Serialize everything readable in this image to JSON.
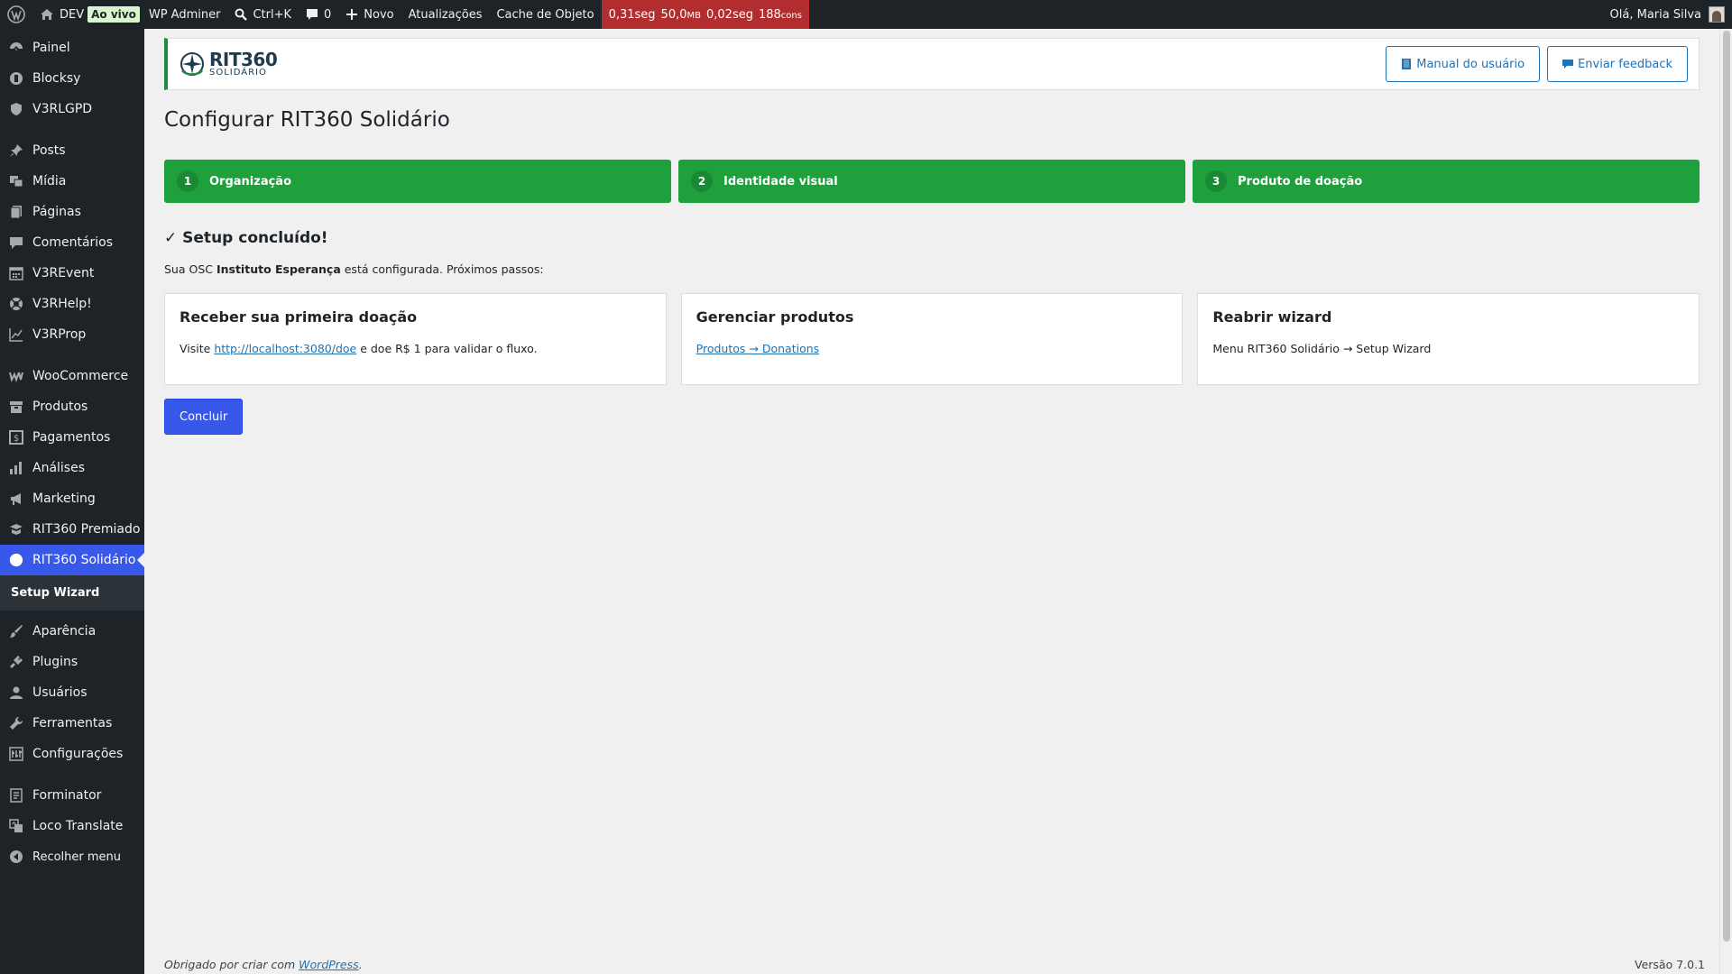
{
  "adminbar": {
    "site": "DEV",
    "live_badge": "Ao vivo",
    "adminer": "WP Adminer",
    "search": "Ctrl+K",
    "comments_count": "0",
    "new": "Novo",
    "updates": "Atualizações",
    "cache": "Cache de Objeto",
    "perf": {
      "time1": "0,31seg",
      "mem_value": "50,0",
      "mem_unit": "MB",
      "time2": "0,02seg",
      "queries_value": "188",
      "queries_unit": "cons"
    },
    "greeting": "Olá, Maria Silva"
  },
  "sidebar": {
    "items": [
      {
        "label": "Painel",
        "icon": "dashboard-icon"
      },
      {
        "label": "Blocksy",
        "icon": "blocksy-icon"
      },
      {
        "label": "V3RLGPD",
        "icon": "shield-icon"
      },
      {
        "label": "Posts",
        "icon": "pin-icon"
      },
      {
        "label": "Mídia",
        "icon": "media-icon"
      },
      {
        "label": "Páginas",
        "icon": "pages-icon"
      },
      {
        "label": "Comentários",
        "icon": "comment-icon"
      },
      {
        "label": "V3REvent",
        "icon": "calendar-icon"
      },
      {
        "label": "V3RHelp!",
        "icon": "help-icon"
      },
      {
        "label": "V3RProp",
        "icon": "chart-line-icon"
      },
      {
        "label": "WooCommerce",
        "icon": "woo-icon"
      },
      {
        "label": "Produtos",
        "icon": "archive-icon"
      },
      {
        "label": "Pagamentos",
        "icon": "money-icon"
      },
      {
        "label": "Análises",
        "icon": "bar-chart-icon"
      },
      {
        "label": "Marketing",
        "icon": "megaphone-icon"
      },
      {
        "label": "RIT360 Premiado",
        "icon": "award-icon"
      },
      {
        "label": "RIT360 Solidário",
        "icon": "circle-icon"
      },
      {
        "label": "Aparência",
        "icon": "brush-icon"
      },
      {
        "label": "Plugins",
        "icon": "plugin-icon"
      },
      {
        "label": "Usuários",
        "icon": "user-icon"
      },
      {
        "label": "Ferramentas",
        "icon": "wrench-icon"
      },
      {
        "label": "Configurações",
        "icon": "settings-icon"
      },
      {
        "label": "Forminator",
        "icon": "form-icon"
      },
      {
        "label": "Loco Translate",
        "icon": "translate-icon"
      }
    ],
    "submenu": "Setup Wizard",
    "collapse": "Recolher menu"
  },
  "header": {
    "logo_main": "RIT360",
    "logo_sub": "SOLIDÁRIO",
    "manual_btn": "Manual do usuário",
    "feedback_btn": "Enviar feedback"
  },
  "page_title": "Configurar RIT360 Solidário",
  "steps": [
    {
      "num": "1",
      "label": "Organização"
    },
    {
      "num": "2",
      "label": "Identidade visual"
    },
    {
      "num": "3",
      "label": "Produto de doação"
    }
  ],
  "done": {
    "title": "✓ Setup concluído!",
    "pre": "Sua OSC ",
    "org": "Instituto Esperança",
    "post": " está configurada. Próximos passos:"
  },
  "cards": [
    {
      "title": "Receber sua primeira doação",
      "pre": "Visite ",
      "link": "http://localhost:3080/doe",
      "post": " e doe R$ 1 para validar o fluxo."
    },
    {
      "title": "Gerenciar produtos",
      "link": "Produtos → Donations"
    },
    {
      "title": "Reabrir wizard",
      "text": "Menu RIT360 Solidário → Setup Wizard"
    }
  ],
  "primary_btn": "Concluir",
  "footer": {
    "pre": "Obrigado por criar com ",
    "link": "WordPress",
    "post": ".",
    "version": "Versão 7.0.1"
  },
  "colors": {
    "step_green": "#1ea03c",
    "accent_blue": "#3858e9",
    "admin_dark": "#1d2327",
    "perf_red": "#b32d2e"
  }
}
